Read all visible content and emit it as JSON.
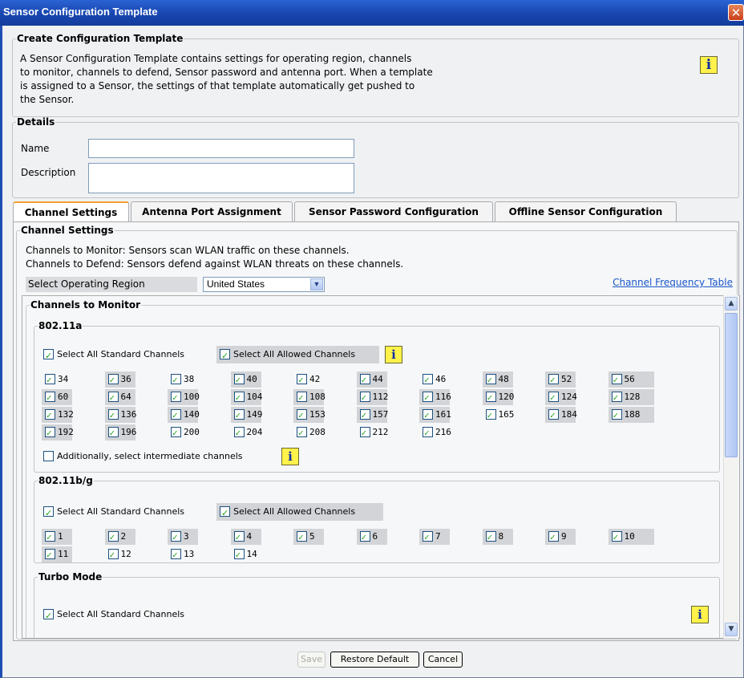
{
  "window": {
    "title": "Sensor Configuration Template",
    "close_glyph": "✕"
  },
  "create": {
    "legend": "Create Configuration Template",
    "description_lines": [
      "A Sensor Configuration Template contains settings for operating region, channels",
      "to monitor, channels to defend, Sensor password and antenna port. When a template",
      "is assigned to a Sensor, the settings of that template automatically get pushed to",
      "the Sensor."
    ],
    "info_glyph": "i"
  },
  "details": {
    "legend": "Details",
    "name_label": "Name",
    "name_value": "",
    "description_label": "Description",
    "description_value": ""
  },
  "tabs": [
    {
      "label": "Channel Settings",
      "active": true
    },
    {
      "label": "Antenna Port Assignment",
      "active": false
    },
    {
      "label": "Sensor Password Configuration",
      "active": false
    },
    {
      "label": "Offline Sensor Configuration",
      "active": false
    }
  ],
  "channel_settings": {
    "legend": "Channel Settings",
    "line1": "Channels to Monitor: Sensors scan WLAN traffic on these channels.",
    "line2": "Channels to Defend: Sensors defend against WLAN threats on these channels.",
    "region_label": "Select Operating Region",
    "region_value": "United States",
    "link": "Channel Frequency Table"
  },
  "monitor": {
    "legend": "Channels to Monitor",
    "a": {
      "legend": "802.11a",
      "select_standard": "Select All Standard Channels",
      "select_allowed": "Select All Allowed Channels",
      "channels": [
        {
          "n": "34",
          "on": true,
          "s": false
        },
        {
          "n": "36",
          "on": true,
          "s": true
        },
        {
          "n": "38",
          "on": true,
          "s": false
        },
        {
          "n": "40",
          "on": true,
          "s": true
        },
        {
          "n": "42",
          "on": true,
          "s": false
        },
        {
          "n": "44",
          "on": true,
          "s": true
        },
        {
          "n": "46",
          "on": true,
          "s": false
        },
        {
          "n": "48",
          "on": true,
          "s": true
        },
        {
          "n": "52",
          "on": true,
          "s": true
        },
        {
          "n": "56",
          "on": true,
          "s": true
        },
        {
          "n": "60",
          "on": true,
          "s": true
        },
        {
          "n": "64",
          "on": true,
          "s": true
        },
        {
          "n": "100",
          "on": true,
          "s": true
        },
        {
          "n": "104",
          "on": true,
          "s": true
        },
        {
          "n": "108",
          "on": true,
          "s": true
        },
        {
          "n": "112",
          "on": true,
          "s": true
        },
        {
          "n": "116",
          "on": true,
          "s": true
        },
        {
          "n": "120",
          "on": true,
          "s": true
        },
        {
          "n": "124",
          "on": true,
          "s": true
        },
        {
          "n": "128",
          "on": true,
          "s": true
        },
        {
          "n": "132",
          "on": true,
          "s": true
        },
        {
          "n": "136",
          "on": true,
          "s": true
        },
        {
          "n": "140",
          "on": true,
          "s": true
        },
        {
          "n": "149",
          "on": true,
          "s": true
        },
        {
          "n": "153",
          "on": true,
          "s": true
        },
        {
          "n": "157",
          "on": true,
          "s": true
        },
        {
          "n": "161",
          "on": true,
          "s": true
        },
        {
          "n": "165",
          "on": true,
          "s": false
        },
        {
          "n": "184",
          "on": true,
          "s": true
        },
        {
          "n": "188",
          "on": true,
          "s": true
        },
        {
          "n": "192",
          "on": true,
          "s": true
        },
        {
          "n": "196",
          "on": true,
          "s": true
        },
        {
          "n": "200",
          "on": true,
          "s": false
        },
        {
          "n": "204",
          "on": true,
          "s": false
        },
        {
          "n": "208",
          "on": true,
          "s": false
        },
        {
          "n": "212",
          "on": true,
          "s": false
        },
        {
          "n": "216",
          "on": true,
          "s": false
        }
      ],
      "intermediate": "Additionally, select intermediate channels"
    },
    "bg": {
      "legend": "802.11b/g",
      "select_standard": "Select All Standard Channels",
      "select_allowed": "Select All Allowed Channels",
      "channels": [
        {
          "n": "1",
          "on": true,
          "s": true
        },
        {
          "n": "2",
          "on": true,
          "s": true
        },
        {
          "n": "3",
          "on": true,
          "s": true
        },
        {
          "n": "4",
          "on": true,
          "s": true
        },
        {
          "n": "5",
          "on": true,
          "s": true
        },
        {
          "n": "6",
          "on": true,
          "s": true
        },
        {
          "n": "7",
          "on": true,
          "s": true
        },
        {
          "n": "8",
          "on": true,
          "s": true
        },
        {
          "n": "9",
          "on": true,
          "s": true
        },
        {
          "n": "10",
          "on": true,
          "s": true
        },
        {
          "n": "11",
          "on": true,
          "s": true
        },
        {
          "n": "12",
          "on": true,
          "s": false
        },
        {
          "n": "13",
          "on": true,
          "s": false
        },
        {
          "n": "14",
          "on": true,
          "s": false
        }
      ]
    },
    "turbo": {
      "legend": "Turbo Mode",
      "select_standard": "Select All Standard Channels"
    }
  },
  "buttons": {
    "save": "Save",
    "restore": "Restore Default",
    "cancel": "Cancel"
  }
}
